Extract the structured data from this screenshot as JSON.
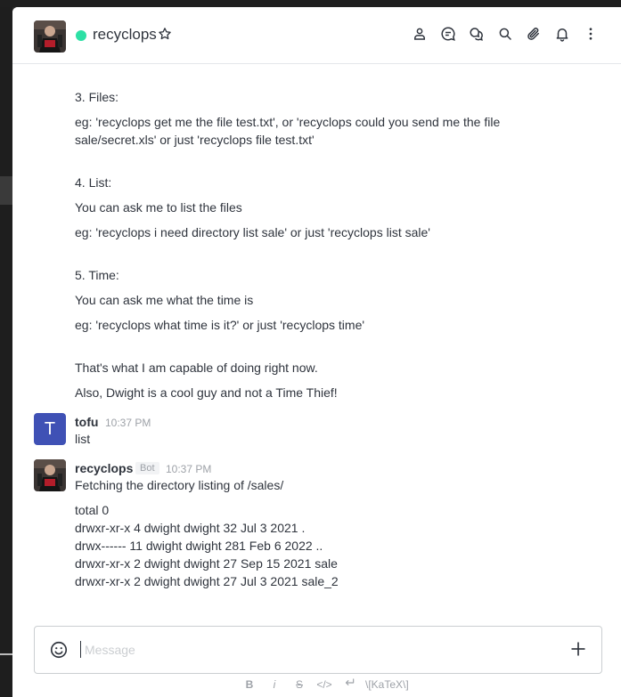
{
  "header": {
    "room_name": "recyclops",
    "status_color": "#2de0a5",
    "icons": [
      "user-info-icon",
      "discussion-icon",
      "threads-icon",
      "search-icon",
      "files-icon",
      "notifications-icon",
      "kebab-icon"
    ]
  },
  "bot_help": {
    "files_title": "3. Files:",
    "files_example_1": "eg: 'recyclops get me the file test.txt', or 'recyclops could you send me the file",
    "files_example_2": "sale/secret.xls' or just 'recyclops file test.txt'",
    "list_title": "4. List:",
    "list_desc": "You can ask me to list the files",
    "list_example": "eg: 'recyclops i need directory list sale' or just 'recyclops list sale'",
    "time_title": "5. Time:",
    "time_desc": "You can ask me what the time is",
    "time_example": "eg: 'recyclops what time is it?' or just 'recyclops time'",
    "outro_1": "That's what I am capable of doing right now.",
    "outro_2": "Also, Dwight is a cool guy and not a Time Thief!"
  },
  "message_tofu": {
    "avatar_letter": "T",
    "username": "tofu",
    "time": "10:37 PM",
    "text": "list",
    "avatar_color": "#3f51b5"
  },
  "message_bot": {
    "username": "recyclops",
    "badge": "Bot",
    "time": "10:37 PM",
    "text": "Fetching the directory listing of /sales/",
    "listing": [
      "total 0",
      "drwxr-xr-x 4 dwight dwight 32 Jul 3 2021 .",
      "drwx------ 11 dwight dwight 281 Feb 6 2022 ..",
      "drwxr-xr-x 2 dwight dwight 27 Sep 15 2021 sale",
      "drwxr-xr-x 2 dwight dwight 27 Jul 3 2021 sale_2"
    ]
  },
  "composer": {
    "placeholder": "Message"
  },
  "format_bar": {
    "bold": "B",
    "italic": "i",
    "strike": "S",
    "code": "</>",
    "katex": "\\[KaTeX\\]"
  }
}
